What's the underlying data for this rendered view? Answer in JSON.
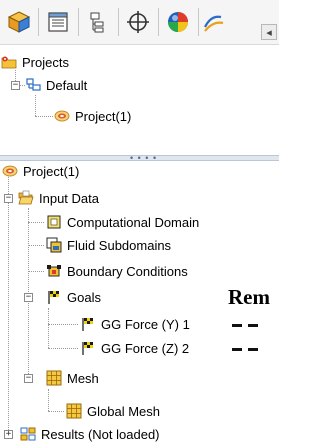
{
  "toolbar": {
    "buttons": [
      {
        "name": "feature-manager-tab",
        "icon": "part-cube-icon"
      },
      {
        "name": "property-manager-tab",
        "icon": "property-list-icon"
      },
      {
        "name": "configuration-manager-tab",
        "icon": "configuration-icon"
      },
      {
        "name": "dimxpert-tab",
        "icon": "crosshair-icon"
      },
      {
        "name": "display-manager-tab",
        "icon": "appearance-sphere-icon"
      },
      {
        "name": "flow-simulation-tab",
        "icon": "flow-simulation-icon"
      }
    ],
    "more_arrow": "◂"
  },
  "top_tree": {
    "root": "Projects",
    "child": "Default",
    "grandchild": "Project(1)"
  },
  "bottom_tree": {
    "root": "Project(1)",
    "input_data": "Input Data",
    "computational_domain": "Computational Domain",
    "fluid_subdomains": "Fluid Subdomains",
    "boundary_conditions": "Boundary Conditions",
    "goals": "Goals",
    "goal_1": "GG Force (Y) 1",
    "goal_2": "GG Force (Z) 2",
    "mesh": "Mesh",
    "global_mesh": "Global Mesh",
    "results": "Results (Not loaded)"
  },
  "overlay": {
    "text": "Rem"
  },
  "colors": {
    "selection_folder": "#f2c12e",
    "accent_blue": "#2b6cc4",
    "goal_flag": "#e8c400"
  }
}
